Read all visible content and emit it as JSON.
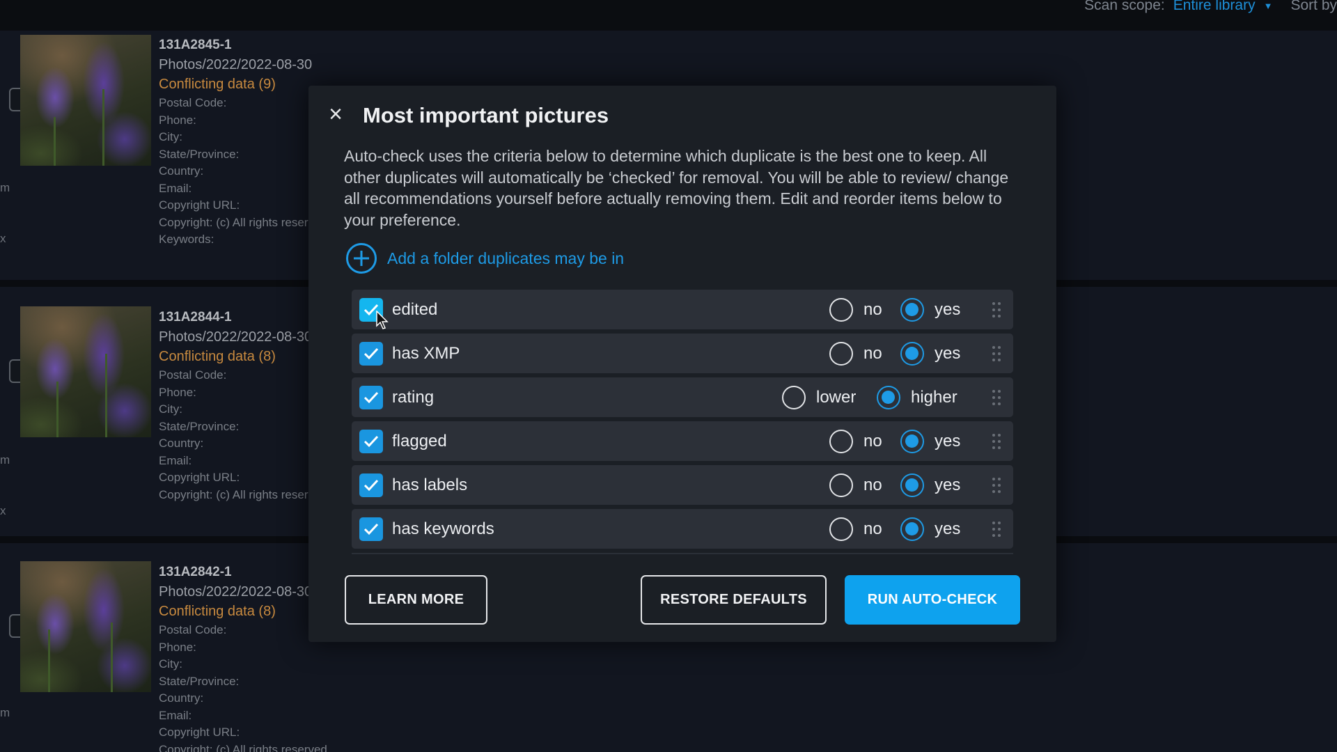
{
  "header": {
    "scan_scope_label": "Scan scope:",
    "scan_scope_value": "Entire library",
    "sort_label": "Sort by"
  },
  "items": [
    {
      "name": "131A2845-1",
      "path": "Photos/2022/2022-08-30",
      "conflict": "Conflicting data (9)",
      "fields": [
        "Postal Code:",
        "Phone:",
        "City:",
        "State/Province:",
        "Country:",
        "Email:",
        "Copyright URL:",
        "Copyright: (c) All rights reserved",
        "Keywords:"
      ]
    },
    {
      "name": "131A2844-1",
      "path": "Photos/2022/2022-08-30",
      "conflict": "Conflicting data (8)",
      "fields": [
        "Postal Code:",
        "Phone:",
        "City:",
        "State/Province:",
        "Country:",
        "Email:",
        "Copyright URL:",
        "Copyright: (c) All rights reserved"
      ]
    },
    {
      "name": "131A2842-1",
      "path": "Photos/2022/2022-08-30",
      "conflict": "Conflicting data (8)",
      "fields": [
        "Postal Code:",
        "Phone:",
        "City:",
        "State/Province:",
        "Country:",
        "Email:",
        "Copyright URL:",
        "Copyright: (c) All rights reserved"
      ]
    }
  ],
  "dialog": {
    "close_icon": "×",
    "title": "Most important pictures",
    "description": "Auto-check uses the criteria below to determine which duplicate is the best one to keep. All other duplicates will automatically be ‘checked’ for removal. You will be able to review/ change all recommendations yourself before actually removing them. Edit and reorder items below to your preference.",
    "add_folder_label": "Add a folder duplicates may be in",
    "criteria": [
      {
        "label": "edited",
        "checked": true,
        "opt_a": "no",
        "opt_b": "yes",
        "selected": "b"
      },
      {
        "label": "has XMP",
        "checked": true,
        "opt_a": "no",
        "opt_b": "yes",
        "selected": "b"
      },
      {
        "label": "rating",
        "checked": true,
        "opt_a": "lower",
        "opt_b": "higher",
        "selected": "b"
      },
      {
        "label": "flagged",
        "checked": true,
        "opt_a": "no",
        "opt_b": "yes",
        "selected": "b"
      },
      {
        "label": "has labels",
        "checked": true,
        "opt_a": "no",
        "opt_b": "yes",
        "selected": "b"
      },
      {
        "label": "has keywords",
        "checked": true,
        "opt_a": "no",
        "opt_b": "yes",
        "selected": "b"
      }
    ],
    "buttons": {
      "learn_more": "LEARN MORE",
      "restore_defaults": "RESTORE DEFAULTS",
      "run_auto_check": "RUN AUTO-CHECK"
    }
  },
  "colors": {
    "accent": "#1e9be6",
    "primary_button": "#0ea2ee",
    "conflict_text": "#c88a3f",
    "dialog_bg": "#1b1f25",
    "row_bg": "#2c3038"
  }
}
